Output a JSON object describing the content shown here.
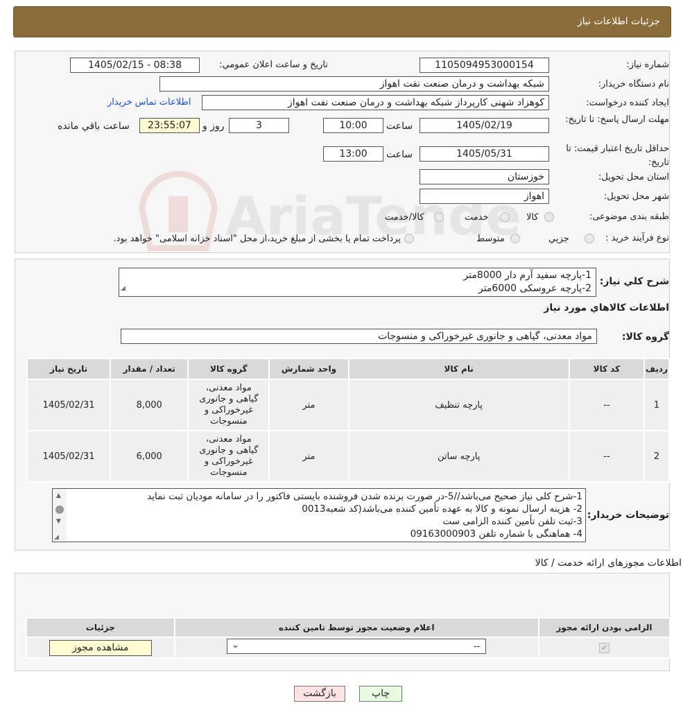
{
  "header": {
    "title": "جزئیات اطلاعات نیاز"
  },
  "form": {
    "need_number_label": "شماره نیاز:",
    "need_number": "1105094953000154",
    "announce_label": "تاریخ و ساعت اعلان عمومي:",
    "announce_value": "1405/02/15 - 08:38",
    "buyer_org_label": "نام دستگاه خریدار:",
    "buyer_org": "شبکه بهداشت و درمان صنعت نفت اهواز",
    "creator_label": "ایجاد کننده درخواست:",
    "creator": "کوهزاد شهنی کارپرداز شبکه بهداشت و درمان صنعت نفت اهواز",
    "contact_link": "اطلاعات تماس خریدار",
    "reply_deadline_label": "مهلت ارسال پاسخ: تا تاریخ:",
    "reply_date": "1405/02/19",
    "time_label": "ساعت",
    "reply_time": "10:00",
    "days_value": "3",
    "days_label": "روز و",
    "remaining_time": "23:55:07",
    "remaining_label": "ساعت باقي مانده",
    "validity_label": "حداقل تاریخ اعتبار قیمت: تا تاریخ:",
    "validity_date": "1405/05/31",
    "validity_time": "13:00",
    "province_label": "استان محل تحویل:",
    "province": "خوزستان",
    "city_label": "شهر محل تحویل:",
    "city": "اهواز",
    "category_label": "طبقه بندی موضوعی:",
    "category_options": [
      "کالا",
      "خدمت",
      "کالا/خدمت"
    ],
    "purchase_type_label": "نوع فرآیند خرید :",
    "purchase_options": [
      "جزیي",
      "متوسط"
    ],
    "purchase_note": "پرداخت تمام یا بخشی از مبلغ خرید،از محل \"اسناد خزانه اسلامی\" خواهد بود."
  },
  "summary": {
    "label": "شرح کلي نیاز:",
    "lines": [
      "1-پارچه سفید آرم دار 8000متر",
      "2-پارچه عروسکی 6000متر"
    ],
    "goods_info_title": "اطلاعات کالاهاي مورد نیاز",
    "group_label": "گروه کالا:",
    "group_value": "مواد معدنی، گیاهی و جانوری غیرخوراکی و منسوجات"
  },
  "items_table": {
    "headers": [
      "ردیف",
      "کد کالا",
      "نام کالا",
      "واحد شمارش",
      "گروه کالا",
      "تعداد / مقدار",
      "تاریخ نیاز"
    ],
    "rows": [
      {
        "row": "1",
        "code": "--",
        "name": "پارچه تنظیف",
        "unit": "متر",
        "group": "مواد معدنی، گیاهی و جانوری غیرخوراکی و منسوجات",
        "qty": "8,000",
        "date": "1405/02/31"
      },
      {
        "row": "2",
        "code": "--",
        "name": "پارچه ساتن",
        "unit": "متر",
        "group": "مواد معدنی، گیاهی و جانوری غیرخوراکی و منسوجات",
        "qty": "6,000",
        "date": "1405/02/31"
      }
    ]
  },
  "buyer_notes": {
    "label": "توضیحات خریدار:",
    "lines": [
      "1-شرح کلی نیاز صحیح می‌باشد//5-در صورت برنده شدن فروشنده بایستی فاکتور را در سامانه مودیان ثبت نماید",
      "2- هزینه ارسال نمونه و کالا به عهده تأمین کننده می‌باشد(کد شعبه0013",
      "3-ثبت تلفن تأمین کننده الزامی ست",
      "4- هماهنگی با شماره تلفن 09163000903"
    ]
  },
  "permits": {
    "section_title": "اطلاعات مجوزهای ارائه خدمت / کالا",
    "headers": [
      "الزامی بودن ارائه مجوز",
      "اعلام وضعیت مجوز توسط تامین کننده",
      "جزئیات"
    ],
    "select_value": "--",
    "view_button": "مشاهده مجوز"
  },
  "buttons": {
    "print": "چاپ",
    "back": "بازگشت"
  },
  "watermark": {
    "text": "AriaTender.neT"
  },
  "colors": {
    "header_bg": "#8a6d3b",
    "link": "#1a4fd6",
    "back_btn_bg": "#fde3e3",
    "print_btn_bg": "#e8fbe0",
    "yellow_field": "#fffbd2"
  }
}
